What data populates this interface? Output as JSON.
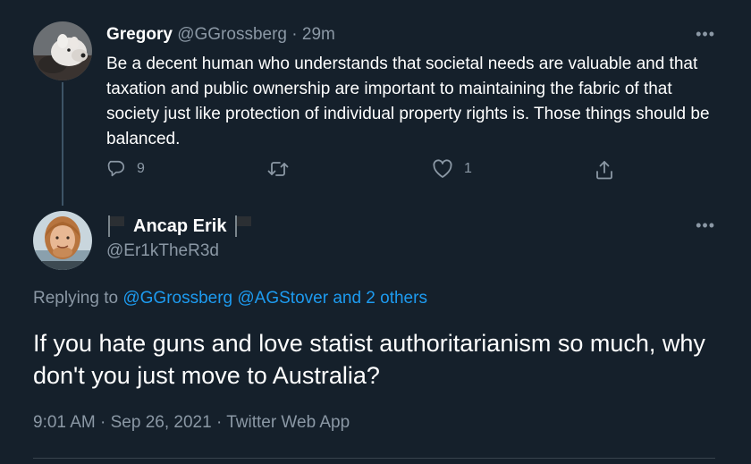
{
  "reply_tweet": {
    "display_name": "Gregory",
    "handle": "@GGrossberg",
    "separator": "·",
    "time": "29m",
    "text": "Be a decent human who understands that societal needs are valuable and that taxation and public ownership are important to maintaining the fabric of that society just like protection of individual property rights is. Those things should be balanced.",
    "more_label": "•••",
    "reply_count": "9",
    "retweet_count": "",
    "like_count": "1"
  },
  "main_tweet": {
    "display_name": "Ancap Erik",
    "handle": "@Er1kTheR3d",
    "more_label": "•••",
    "replying_prefix": "Replying to",
    "replying_mentions": "@GGrossberg @AGStover and 2 others",
    "text": "If you hate guns and love statist authoritarianism so much, why don't you just move to Australia?",
    "time": "9:01 AM",
    "date": "Sep 26, 2021",
    "source": "Twitter Web App",
    "meta_separator": "·"
  },
  "icons": [
    "reply-icon",
    "retweet-icon",
    "like-icon",
    "share-icon",
    "black-flag-icon",
    "more-icon"
  ],
  "colors": {
    "background": "#15202b",
    "text": "#ffffff",
    "muted": "#8b98a5",
    "link": "#1d9bf0",
    "thread_line": "#3d5466"
  }
}
